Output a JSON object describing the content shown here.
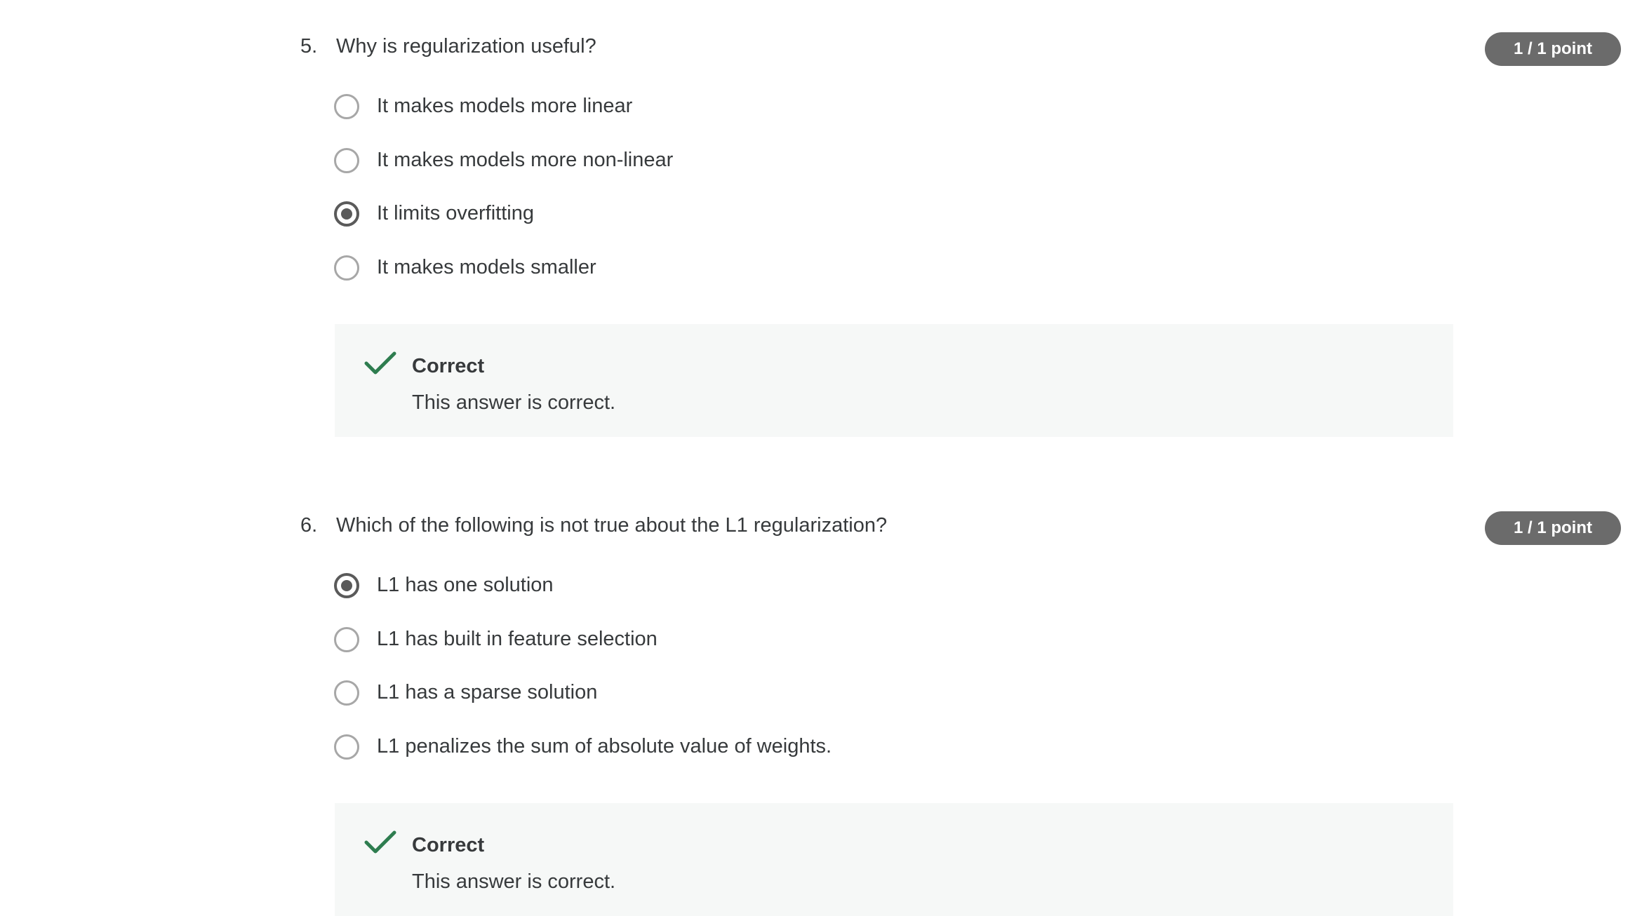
{
  "questions": [
    {
      "number": "5.",
      "text": "Why is regularization useful?",
      "points": "1 / 1 point",
      "options": [
        {
          "label": "It makes models more linear",
          "selected": false
        },
        {
          "label": "It makes models more non-linear",
          "selected": false
        },
        {
          "label": "It limits overfitting",
          "selected": true
        },
        {
          "label": "It makes models smaller",
          "selected": false
        }
      ],
      "feedback": {
        "status": "Correct",
        "message": "This answer is correct.",
        "icon": "checkmark-icon",
        "color": "#2e7d4f"
      }
    },
    {
      "number": "6.",
      "text": "Which of the following is not true about the L1 regularization?",
      "points": "1 / 1 point",
      "options": [
        {
          "label": "L1 has one solution",
          "selected": true
        },
        {
          "label": "L1 has built in feature selection",
          "selected": false
        },
        {
          "label": "L1 has a sparse solution",
          "selected": false
        },
        {
          "label": "L1 penalizes the sum of absolute value of weights.",
          "selected": false
        }
      ],
      "feedback": {
        "status": "Correct",
        "message": "This answer is correct.",
        "icon": "checkmark-icon",
        "color": "#2e7d4f"
      }
    }
  ]
}
